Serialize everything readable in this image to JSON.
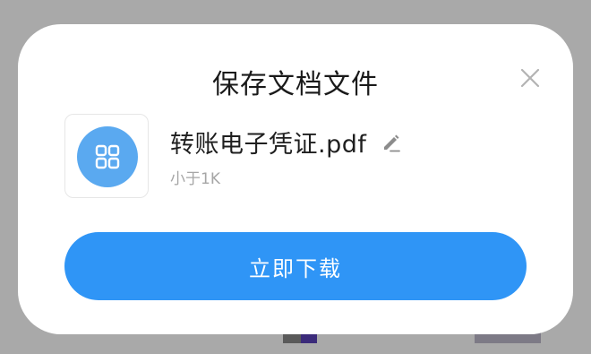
{
  "dialog": {
    "title": "保存文档文件",
    "close_icon": "close-icon"
  },
  "file": {
    "icon": "grid-apps-icon",
    "name": "转账电子凭证.pdf",
    "edit_icon": "pencil-edit-icon",
    "size": "小于1K"
  },
  "actions": {
    "download_label": "立即下载"
  },
  "colors": {
    "accent": "#2f95f6",
    "file_icon_bg": "#5aa9f0",
    "overlay": "#a9a9a9"
  }
}
